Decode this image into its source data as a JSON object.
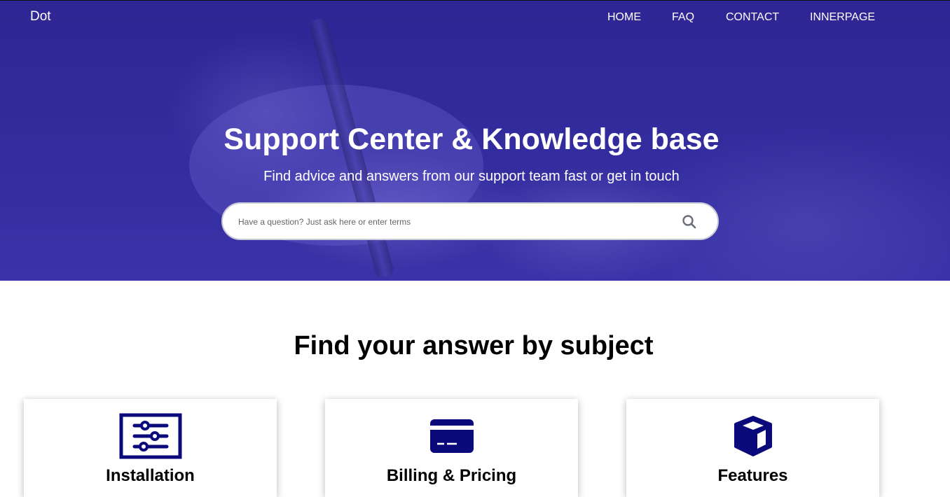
{
  "header": {
    "logo": "Dot",
    "nav": [
      {
        "label": "HOME"
      },
      {
        "label": "FAQ"
      },
      {
        "label": "CONTACT"
      },
      {
        "label": "INNERPAGE"
      }
    ]
  },
  "hero": {
    "title": "Support Center & Knowledge base",
    "subtitle": "Find advice and answers from our support team fast or get in touch",
    "search_placeholder": "Have a question? Just ask here or enter terms",
    "search_icon": "search-icon"
  },
  "subjects": {
    "title": "Find your answer by subject",
    "cards": [
      {
        "title": "Installation",
        "icon": "sliders-icon"
      },
      {
        "title": "Billing & Pricing",
        "icon": "credit-card-icon"
      },
      {
        "title": "Features",
        "icon": "cube-icon"
      }
    ]
  },
  "colors": {
    "hero_bg": "#322b9c",
    "icon": "#0a0a7a",
    "text_light": "#ffffff"
  }
}
